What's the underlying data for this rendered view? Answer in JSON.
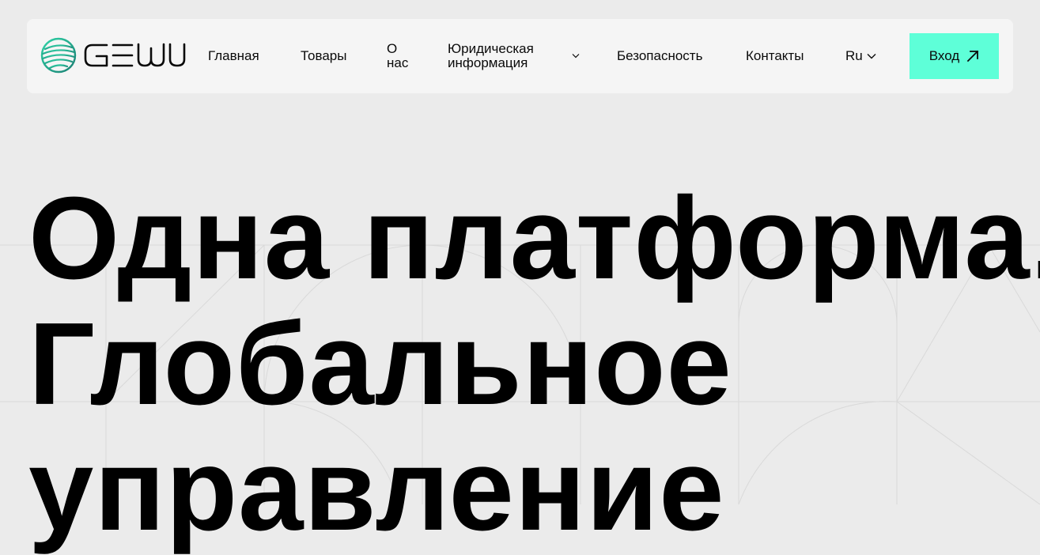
{
  "header": {
    "logo_text": "GEWU",
    "nav": [
      {
        "label": "Главная"
      },
      {
        "label": "Товары"
      },
      {
        "label": "О нас"
      },
      {
        "label": "Юридическая информация"
      },
      {
        "label": "Безопасность"
      },
      {
        "label": "Контакты"
      }
    ],
    "language": "Ru",
    "login_label": "Вход"
  },
  "hero": {
    "lines": [
      "Одна платформа.",
      "Глобальное",
      "управление"
    ]
  },
  "colors": {
    "accent": "#5effd8",
    "logo_gradient_start": "#2fd4a7",
    "logo_gradient_end": "#1a7f73",
    "background": "#ebebeb",
    "nav_background": "#f5f5f5"
  }
}
